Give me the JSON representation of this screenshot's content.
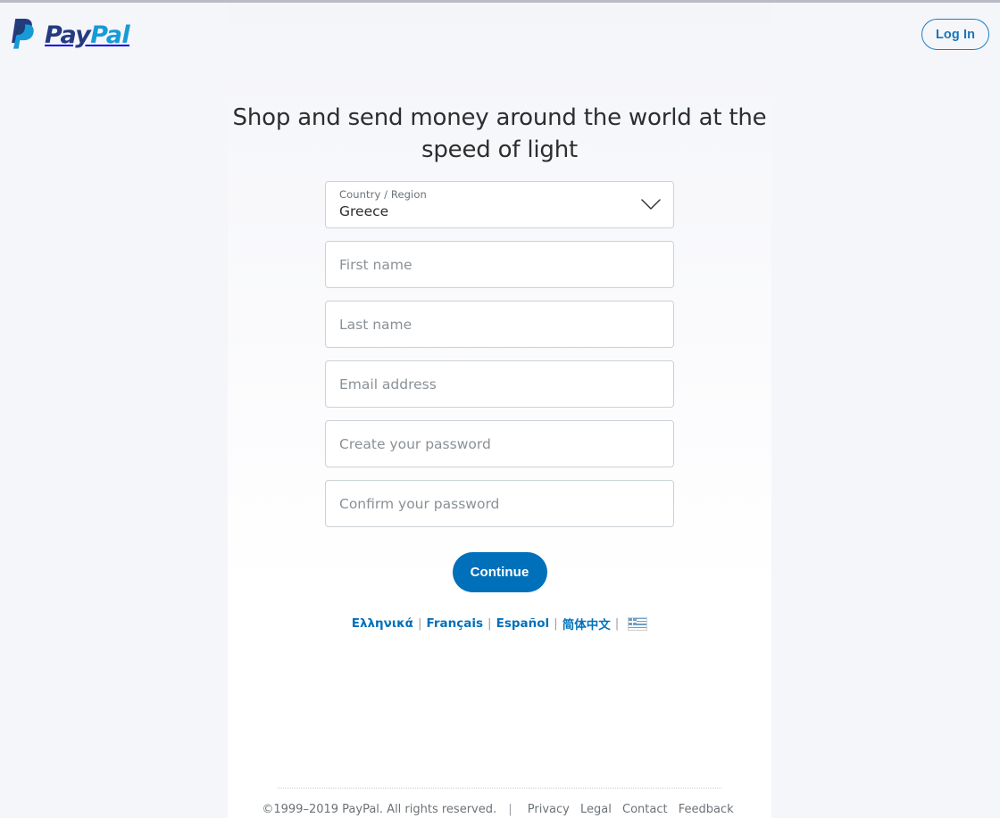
{
  "header": {
    "brand_pay": "Pay",
    "brand_pal": "Pal",
    "brand_mark_icon": "paypal-p-icon",
    "login_label": "Log In"
  },
  "main": {
    "headline": "Shop and send money around the world at the speed of light",
    "country_field": {
      "label": "Country / Region",
      "value": "Greece",
      "chevron_icon": "chevron-down-icon"
    },
    "inputs": [
      {
        "name": "first-name",
        "placeholder": "First name",
        "value": ""
      },
      {
        "name": "last-name",
        "placeholder": "Last name",
        "value": ""
      },
      {
        "name": "email",
        "placeholder": "Email address",
        "value": ""
      },
      {
        "name": "password",
        "placeholder": "Create your password",
        "value": ""
      },
      {
        "name": "confirm-password",
        "placeholder": "Confirm your password",
        "value": ""
      }
    ],
    "continue_label": "Continue"
  },
  "languages": {
    "items": [
      {
        "label": "Ελληνικά"
      },
      {
        "label": "Français"
      },
      {
        "label": "Español"
      },
      {
        "label": "简体中文"
      }
    ],
    "separator": "|",
    "flag_icon": "greece-flag-icon"
  },
  "footer": {
    "copyright": "©1999–2019 PayPal. All rights reserved.",
    "separator": "|",
    "links": [
      {
        "label": "Privacy"
      },
      {
        "label": "Legal"
      },
      {
        "label": "Contact"
      },
      {
        "label": "Feedback"
      }
    ]
  },
  "colors": {
    "brand_dark": "#253b80",
    "brand_light": "#179bd7",
    "accent": "#0070ba",
    "page_bg": "#f5f6fa",
    "card_bg": "#ffffff",
    "text": "#2c2e2f",
    "muted": "#6c7378",
    "placeholder": "#8a9196",
    "border": "#cbd2d6"
  }
}
